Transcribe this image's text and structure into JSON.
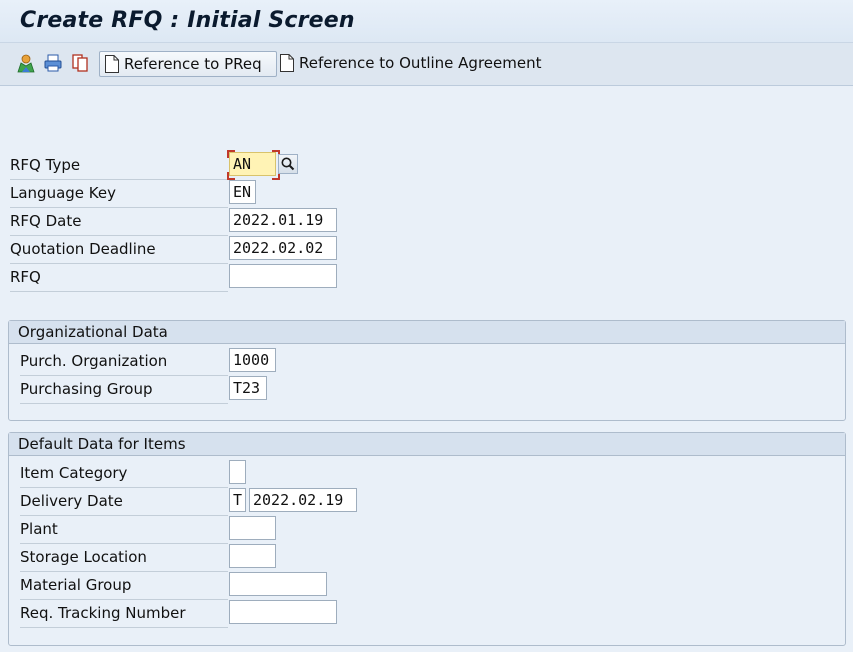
{
  "window": {
    "title": "Create RFQ : Initial Screen"
  },
  "toolbar": {
    "icons": [
      "organization-icon",
      "print-icon",
      "copy-icon"
    ],
    "reference_preq_label": "Reference to PReq",
    "reference_outline_label": "Reference to Outline Agreement"
  },
  "header_fields": {
    "rfq_type": {
      "label": "RFQ Type",
      "value": "AN"
    },
    "language_key": {
      "label": "Language Key",
      "value": "EN"
    },
    "rfq_date": {
      "label": "RFQ Date",
      "value": "2022.01.19"
    },
    "quotation_deadline": {
      "label": "Quotation Deadline",
      "value": "2022.02.02"
    },
    "rfq": {
      "label": "RFQ",
      "value": ""
    }
  },
  "organizational_data": {
    "title": "Organizational Data",
    "purch_org": {
      "label": "Purch. Organization",
      "value": "1000"
    },
    "purch_group": {
      "label": "Purchasing Group",
      "value": "T23"
    }
  },
  "default_data": {
    "title": "Default Data for Items",
    "item_category": {
      "label": "Item Category",
      "value": ""
    },
    "delivery_date": {
      "label": "Delivery Date",
      "type_value": "T",
      "value": "2022.02.19"
    },
    "plant": {
      "label": "Plant",
      "value": ""
    },
    "storage_location": {
      "label": "Storage Location",
      "value": ""
    },
    "material_group": {
      "label": "Material Group",
      "value": ""
    },
    "req_tracking_number": {
      "label": "Req. Tracking Number",
      "value": ""
    }
  },
  "colors": {
    "background": "#e9f0f8",
    "required_field": "#fff3b5",
    "required_marker": "#c0392b"
  }
}
